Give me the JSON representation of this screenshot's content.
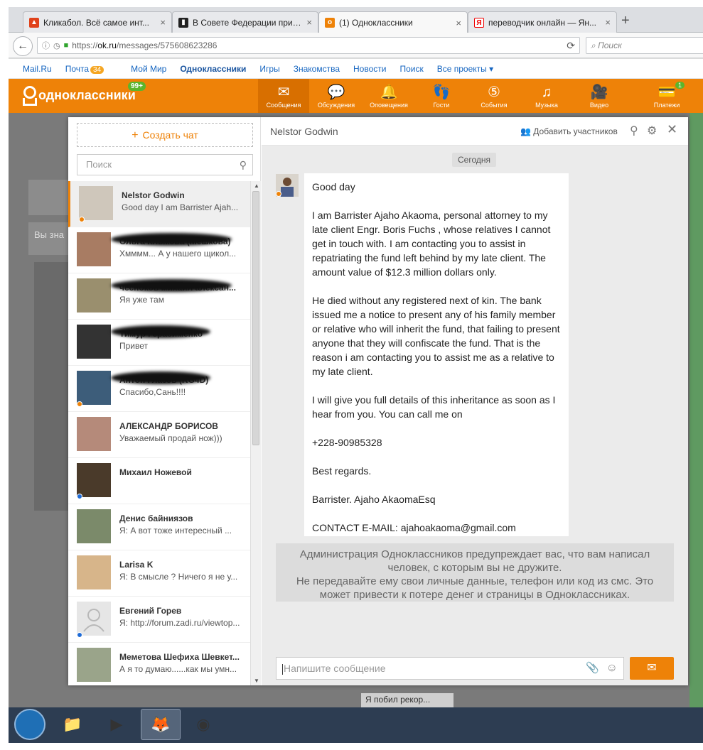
{
  "browser": {
    "tabs": [
      {
        "title": "Кликабол. Всё самое инт...",
        "active": false
      },
      {
        "title": "В Совете Федерации приз...",
        "active": false
      },
      {
        "title": "(1) Одноклассники",
        "active": true
      },
      {
        "title": "переводчик онлайн — Ян...",
        "active": false
      }
    ],
    "url_prefix": "https://",
    "url_host": "ok.ru",
    "url_path": "/messages/575608623286",
    "search_placeholder": "Поиск"
  },
  "mailru_bar": {
    "items": [
      "Mail.Ru",
      "Почта",
      "Мой Мир",
      "Одноклассники",
      "Игры",
      "Знакомства",
      "Новости",
      "Поиск",
      "Все проекты"
    ],
    "mail_badge": "34"
  },
  "ok_header": {
    "logo_text": "одноклассники",
    "logo_badge": "99+",
    "nav": [
      {
        "label": "Сообщения",
        "icon": "envelope-icon"
      },
      {
        "label": "Обсуждения",
        "icon": "chat-bubbles-icon"
      },
      {
        "label": "Оповещения",
        "icon": "bell-icon"
      },
      {
        "label": "Гости",
        "icon": "footprints-icon"
      },
      {
        "label": "События",
        "icon": "events-icon"
      },
      {
        "label": "Музыка",
        "icon": "music-icon"
      },
      {
        "label": "Видео",
        "icon": "video-camera-icon"
      },
      {
        "label": "Платежи",
        "icon": "payments-icon"
      }
    ],
    "payments_badge": "1"
  },
  "chats_panel": {
    "create_label": "Создать чат",
    "search_placeholder": "Поиск",
    "items": [
      {
        "name": "Nelstor Godwin",
        "preview": "Good day I am Barrister Ajah...",
        "selected": true,
        "dot": "#ee8208"
      },
      {
        "name": "Ольга Клыкова (Мешкова)",
        "preview": "Хмммм... А у нашего щикол...",
        "selected": false,
        "dot": ""
      },
      {
        "name": "чесноков михаил алексан...",
        "preview": "Яя уже там",
        "selected": false,
        "dot": ""
      },
      {
        "name": "Тимур Герасименко",
        "preview": "Привет",
        "selected": false,
        "dot": ""
      },
      {
        "name": "Антон Глазов (RG4D)",
        "preview": "Спасибо,Сань!!!!",
        "selected": false,
        "dot": "#ee8208"
      },
      {
        "name": "АЛЕКСАНДР БОРИСОВ",
        "preview": "Уважаемый продай нож)))",
        "selected": false,
        "dot": ""
      },
      {
        "name": "Михаил Ножевой",
        "preview": "",
        "selected": false,
        "dot": "#1e6bd6"
      },
      {
        "name": "Денис байниязов",
        "preview": "Я:  А вот тоже интересный ...",
        "selected": false,
        "dot": ""
      },
      {
        "name": "Larisa K",
        "preview": "Я: В смысле ? Ничего я не у...",
        "selected": false,
        "dot": ""
      },
      {
        "name": "Евгений Горев",
        "preview": "Я: http://forum.zadi.ru/viewtop...",
        "selected": false,
        "dot": "#1e6bd6"
      },
      {
        "name": "Меметова Шефиха Шевкет...",
        "preview": "А я то думаю......как мы умн...",
        "selected": false,
        "dot": ""
      }
    ]
  },
  "conversation": {
    "title": "Nelstor Godwin",
    "add_participants": "Добавить участников",
    "date_label": "Сегодня",
    "message_paragraphs": [
      "Good day",
      "I am Barrister Ajaho Akaoma, personal attorney to my late client Engr. Boris Fuchs , whose relatives I cannot get in touch with. I am contacting you to assist in repatriating the fund left behind by my late client. The amount value of $12.3 million dollars only.",
      "He died without any registered  next of kin. The bank issued me a notice to present any of his family member or relative who will inherit the fund, that failing to present anyone that they will confiscate the fund. That is the reason i am contacting you to assist me as a relative to my late client.",
      "I will give you full details of this inheritance as soon as I hear from you. You can call me on",
      "+228-90985328",
      "Best regards.",
      "Barrister. Ajaho AkaomaEsq",
      "CONTACT E-MAIL: ajahoakaoma@gmail.com"
    ],
    "warning_line1": "Администрация Одноклассников предупреждает вас, что вам написал",
    "warning_line2": "человек, с которым вы не дружите.",
    "warning_line3": "Не передавайте ему свои личные данные, телефон или код из смс. Это",
    "warning_line4": "может привести к потере денег и страницы в Одноклассниках.",
    "input_placeholder": "Напишите сообщение"
  },
  "background_page": {
    "snippet1": "Вы зна",
    "snippet2": "Я побил рекор..."
  },
  "colors": {
    "ok_orange": "#ee8208",
    "online_green": "#5bb52d"
  }
}
